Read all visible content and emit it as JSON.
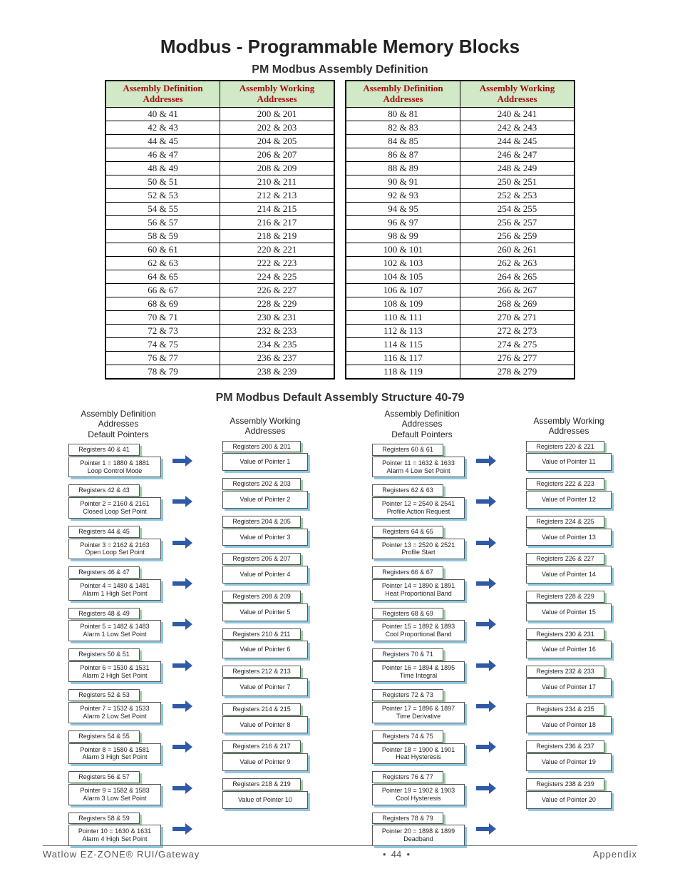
{
  "title": "Modbus - Programmable Memory Blocks",
  "subtitle1": "PM Modbus Assembly Definition",
  "subtitle2": "PM Modbus Default Assembly Structure 40-79",
  "tableHeaders": {
    "def": "Assembly Definition\nAddresses",
    "work": "Assembly Working\nAddresses"
  },
  "tableLeft": [
    [
      "40 & 41",
      "200 & 201"
    ],
    [
      "42 & 43",
      "202 & 203"
    ],
    [
      "44 & 45",
      "204 & 205"
    ],
    [
      "46 & 47",
      "206 & 207"
    ],
    [
      "48 & 49",
      "208 & 209"
    ],
    [
      "50 & 51",
      "210 & 211"
    ],
    [
      "52 & 53",
      "212 & 213"
    ],
    [
      "54 & 55",
      "214 & 215"
    ],
    [
      "56 & 57",
      "216 & 217"
    ],
    [
      "58 & 59",
      "218 & 219"
    ],
    [
      "60 & 61",
      "220 & 221"
    ],
    [
      "62 & 63",
      "222 & 223"
    ],
    [
      "64 & 65",
      "224 & 225"
    ],
    [
      "66 & 67",
      "226 & 227"
    ],
    [
      "68 & 69",
      "228 & 229"
    ],
    [
      "70 & 71",
      "230 & 231"
    ],
    [
      "72 & 73",
      "232 & 233"
    ],
    [
      "74 & 75",
      "234 & 235"
    ],
    [
      "76 & 77",
      "236 & 237"
    ],
    [
      "78 & 79",
      "238 & 239"
    ]
  ],
  "tableRight": [
    [
      "80 & 81",
      "240 & 241"
    ],
    [
      "82 & 83",
      "242 & 243"
    ],
    [
      "84 & 85",
      "244 & 245"
    ],
    [
      "86 & 87",
      "246 & 247"
    ],
    [
      "88 & 89",
      "248 & 249"
    ],
    [
      "90 & 91",
      "250 & 251"
    ],
    [
      "92 & 93",
      "252 & 253"
    ],
    [
      "94 & 95",
      "254 & 255"
    ],
    [
      "96 & 97",
      "256 & 257"
    ],
    [
      "98 & 99",
      "256 & 259"
    ],
    [
      "100 & 101",
      "260 & 261"
    ],
    [
      "102 & 103",
      "262 & 263"
    ],
    [
      "104 & 105",
      "264 & 265"
    ],
    [
      "106 & 107",
      "266 & 267"
    ],
    [
      "108 & 109",
      "268 & 269"
    ],
    [
      "110 & 111",
      "270 & 271"
    ],
    [
      "112 & 113",
      "272 & 273"
    ],
    [
      "114 & 115",
      "274 & 275"
    ],
    [
      "116 & 117",
      "276 & 277"
    ],
    [
      "118 & 119",
      "278 & 279"
    ]
  ],
  "diagHeaders": {
    "leftA": "Assembly Definition\nAddresses\nDefault Pointers",
    "leftB": "Assembly Working\nAddresses"
  },
  "diagramLeft": [
    {
      "reg": "Registers 40 & 41",
      "ptr": "Pointer 1 = 1880 & 1881\nLoop Control Mode",
      "wreg": "Registers 200 & 201",
      "val": "Value of Pointer 1"
    },
    {
      "reg": "Registers 42 & 43",
      "ptr": "Pointer 2 = 2160 & 2161\nClosed Loop Set Point",
      "wreg": "Registers 202 & 203",
      "val": "Value of Pointer 2"
    },
    {
      "reg": "Registers 44 & 45",
      "ptr": "Pointer 3 = 2162 & 2163\nOpen Loop Set Point",
      "wreg": "Registers 204 & 205",
      "val": "Value of Pointer 3"
    },
    {
      "reg": "Registers 46 & 47",
      "ptr": "Pointer 4 = 1480 & 1481\nAlarm 1 High Set Point",
      "wreg": "Registers 206 & 207",
      "val": "Value of Pointer 4"
    },
    {
      "reg": "Registers 48 & 49",
      "ptr": "Pointer 5 = 1482 & 1483\nAlarm 1 Low Set Point",
      "wreg": "Registers 208 & 209",
      "val": "Value of Pointer 5"
    },
    {
      "reg": "Registers 50 & 51",
      "ptr": "Pointer 6 = 1530 & 1531\nAlarm 2 High Set Point",
      "wreg": "Registers 210 & 211",
      "val": "Value of Pointer 6"
    },
    {
      "reg": "Registers 52 & 53",
      "ptr": "Pointer 7 = 1532 & 1533\nAlarm 2 Low Set Point",
      "wreg": "Registers 212 & 213",
      "val": "Value of Pointer 7"
    },
    {
      "reg": "Registers 54 & 55",
      "ptr": "Pointer 8 = 1580 & 1581\nAlarm 3 High Set Point",
      "wreg": "Registers 214 & 215",
      "val": "Value of Pointer 8"
    },
    {
      "reg": "Registers 56 & 57",
      "ptr": "Pointer 9 = 1582 & 1583\nAlarm 3 Low Set Point",
      "wreg": "Registers 216 & 217",
      "val": "Value of Pointer 9"
    },
    {
      "reg": "Registers 58 & 59",
      "ptr": "Pointer 10 = 1630 & 1631\nAlarm 4 High Set Point",
      "wreg": "Registers 218 & 219",
      "val": "Value of Pointer 10"
    }
  ],
  "diagramRight": [
    {
      "reg": "Registers 60 & 61",
      "ptr": "Pointer 11 = 1632 & 1633\nAlarm 4 Low Set Point",
      "wreg": "Registers 220 & 221",
      "val": "Value of Pointer 11"
    },
    {
      "reg": "Registers 62 & 63",
      "ptr": "Pointer 12 = 2540 & 2541\nProfile Action Request",
      "wreg": "Registers 222 & 223",
      "val": "Value of Pointer 12"
    },
    {
      "reg": "Registers 64 & 65",
      "ptr": "Pointer 13 = 2520 & 2521\nProfile Start",
      "wreg": "Registers 224 & 225",
      "val": "Value of Pointer 13"
    },
    {
      "reg": "Registers 66 & 67",
      "ptr": "Pointer 14 = 1890 & 1891\nHeat Proportional Band",
      "wreg": "Registers 226 & 227",
      "val": "Value of Pointer 14"
    },
    {
      "reg": "Registers 68 & 69",
      "ptr": "Pointer 15 = 1892 & 1893\nCool Proportional Band",
      "wreg": "Registers 228 & 229",
      "val": "Value of Pointer 15"
    },
    {
      "reg": "Registers 70 & 71",
      "ptr": "Pointer 16 = 1894 & 1895\nTime Integral",
      "wreg": "Registers 230 & 231",
      "val": "Value of Pointer 16"
    },
    {
      "reg": "Registers 72 & 73",
      "ptr": "Pointer 17 = 1896 & 1897\nTime Derivative",
      "wreg": "Registers 232 & 233",
      "val": "Value of Pointer 17"
    },
    {
      "reg": "Registers 74 & 75",
      "ptr": "Pointer 18 = 1900 & 1901\nHeat Hysteresis",
      "wreg": "Registers 234 & 235",
      "val": "Value of Pointer 18"
    },
    {
      "reg": "Registers 76 & 77",
      "ptr": "Pointer 19 = 1902 & 1903\nCool Hysteresis",
      "wreg": "Registers 236 & 237",
      "val": "Value of Pointer 19"
    },
    {
      "reg": "Registers 78 & 79",
      "ptr": "Pointer 20 = 1898 & 1899\nDeadband",
      "wreg": "Registers 238 & 239",
      "val": "Value of Pointer 20"
    }
  ],
  "footer": {
    "left": "Watlow EZ-ZONE® RUI/Gateway",
    "bullet": "•",
    "page": "44",
    "right": "Appendix"
  }
}
